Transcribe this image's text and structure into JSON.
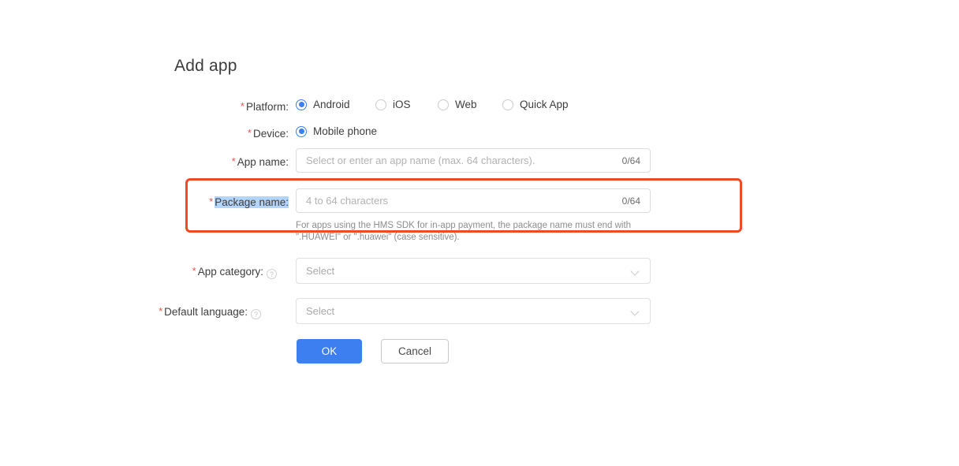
{
  "page": {
    "title": "Add app",
    "accent_blue": "#3d7ef0",
    "required_asterisk_color": "#e8554d",
    "annotation_color": "#ed4a25",
    "selection_highlight_color": "#b4d5fb"
  },
  "form": {
    "platform": {
      "label": "Platform:",
      "required": true,
      "options": [
        {
          "label": "Android",
          "selected": true
        },
        {
          "label": "iOS",
          "selected": false
        },
        {
          "label": "Web",
          "selected": false
        },
        {
          "label": "Quick App",
          "selected": false
        }
      ]
    },
    "device": {
      "label": "Device:",
      "required": true,
      "options": [
        {
          "label": "Mobile phone",
          "selected": true
        }
      ]
    },
    "app_name": {
      "label": "App name:",
      "required": true,
      "value": "",
      "placeholder": "Select or enter an app name (max. 64 characters).",
      "counter": "0/64"
    },
    "package_name": {
      "label": "Package name:",
      "required": true,
      "label_selected": true,
      "value": "",
      "placeholder": "4 to 64 characters",
      "counter": "0/64",
      "hint_line_1": "For apps using the HMS SDK for in-app payment, the package name must end with",
      "hint_line_2": "\".HUAWEI\" or \".huawei\" (case sensitive)."
    },
    "app_category": {
      "label": "App category:",
      "required": true,
      "help_icon": "question-circle-icon",
      "value": "Select",
      "chevron_icon": "chevron-down-icon"
    },
    "default_language": {
      "label": "Default language:",
      "required": true,
      "help_icon": "question-circle-icon",
      "value": "Select",
      "chevron_icon": "chevron-down-icon"
    }
  },
  "actions": {
    "ok_label": "OK",
    "cancel_label": "Cancel"
  }
}
